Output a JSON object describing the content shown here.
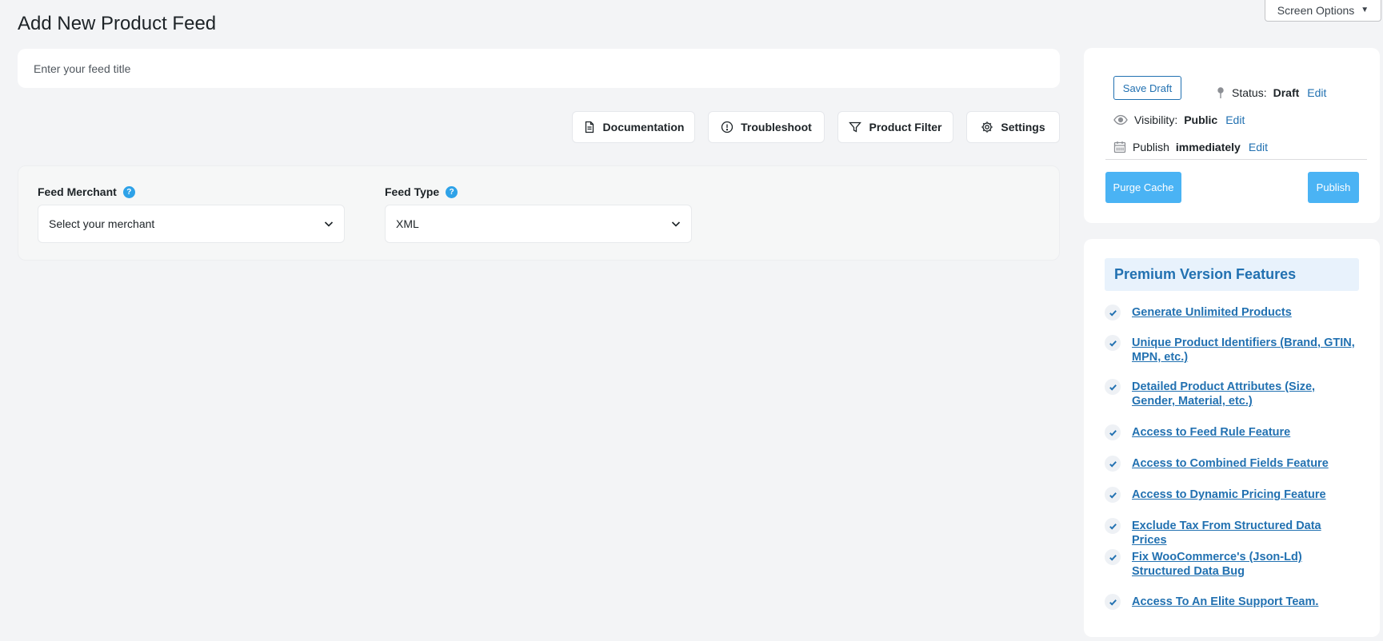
{
  "header": {
    "title": "Add New Product Feed",
    "screen_options": "Screen Options"
  },
  "feed_title": {
    "placeholder": "Enter your feed title",
    "value": ""
  },
  "toolbar": {
    "documentation": "Documentation",
    "troubleshoot": "Troubleshoot",
    "product_filter": "Product Filter",
    "settings": "Settings"
  },
  "config": {
    "merchant": {
      "label": "Feed Merchant",
      "value": "Select your merchant"
    },
    "feed_type": {
      "label": "Feed Type",
      "value": "XML"
    },
    "help_glyph": "?"
  },
  "publish": {
    "save_draft": "Save Draft",
    "status_label": "Status:",
    "status_value": "Draft",
    "visibility_label": "Visibility:",
    "visibility_value": "Public",
    "publish_label": "Publish",
    "publish_when": "immediately",
    "edit": "Edit",
    "purge_cache": "Purge Cache",
    "publish_button": "Publish"
  },
  "premium": {
    "heading": "Premium Version Features",
    "features": [
      "Generate Unlimited Products",
      "Unique Product Identifiers (Brand, GTIN, MPN, etc.)",
      "Detailed Product Attributes (Size, Gender, Material, etc.)",
      "Access to Feed Rule Feature",
      "Access to Combined Fields Feature",
      "Access to Dynamic Pricing Feature",
      "Exclude Tax From Structured Data Prices",
      "Fix WooCommerce's (Json-Ld) Structured Data Bug",
      "Access To An Elite Support Team."
    ]
  },
  "colors": {
    "accent": "#2271b1",
    "primary_button": "#4ab3f4",
    "help_icon": "#2ea2e8",
    "background": "#f3f4f6"
  }
}
